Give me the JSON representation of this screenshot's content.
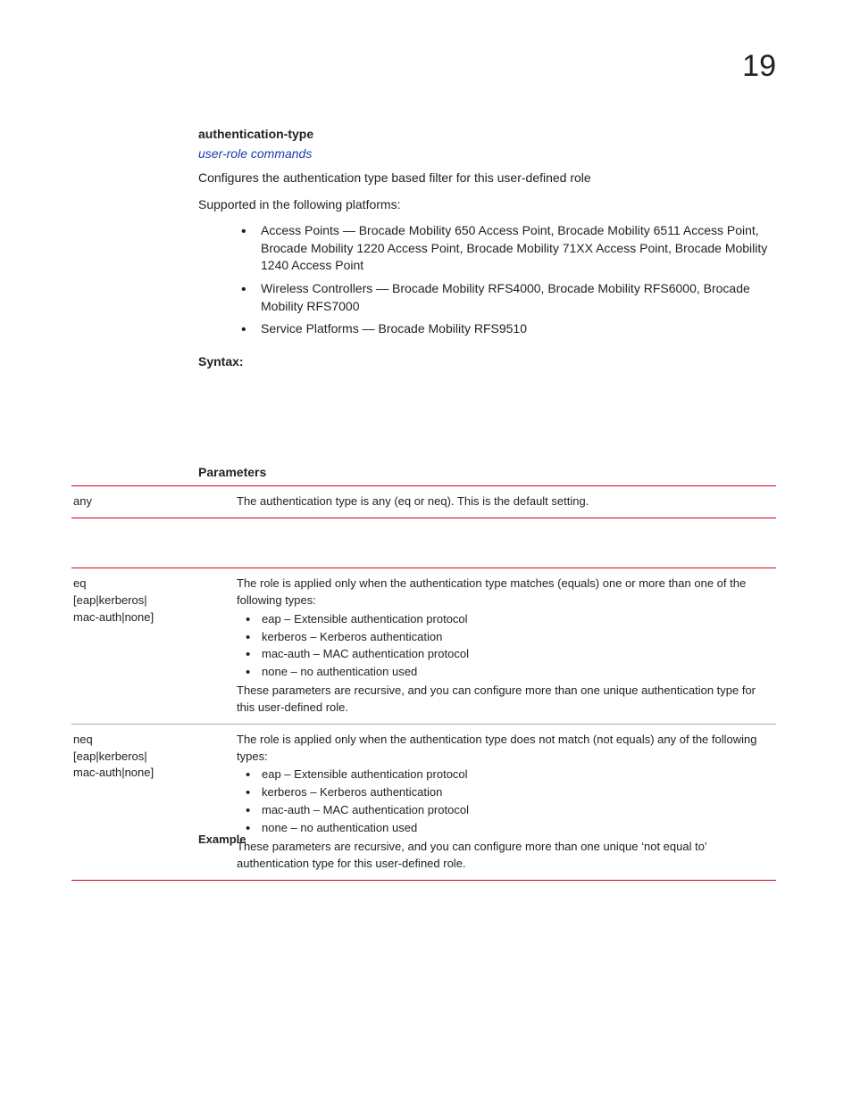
{
  "chapter_number": "19",
  "section": {
    "title": "authentication-type",
    "link": "user-role commands",
    "desc": "Configures the authentication type based filter for this user-defined role",
    "supported_intro": "Supported in the following platforms:",
    "platforms": [
      "Access Points — Brocade Mobility 650 Access Point, Brocade Mobility 6511 Access Point, Brocade Mobility 1220 Access Point, Brocade Mobility 71XX Access Point, Brocade Mobility 1240 Access Point",
      "Wireless Controllers — Brocade Mobility RFS4000, Brocade Mobility RFS6000, Brocade Mobility RFS7000",
      "Service Platforms — Brocade Mobility RFS9510"
    ],
    "syntax_label": "Syntax:",
    "parameters_label": "Parameters"
  },
  "table1": {
    "rows": [
      {
        "left": "any",
        "right_text": "The authentication type is any (eq or neq). This is the default setting."
      }
    ]
  },
  "table2": {
    "rows": [
      {
        "left_lines": [
          "eq",
          "[eap|kerberos|",
          "mac-auth|none]"
        ],
        "intro": "The role is applied only when the authentication type matches (equals) one or more than one of the following types:",
        "items": [
          "eap – Extensible authentication protocol",
          "kerberos – Kerberos authentication",
          "mac-auth – MAC authentication protocol",
          "none – no authentication used"
        ],
        "outro": "These parameters are recursive, and you can configure more than one unique authentication type for this user-defined role."
      },
      {
        "left_lines": [
          "neq",
          "[eap|kerberos|",
          "mac-auth|none]"
        ],
        "intro": "The role is applied only when the authentication type does not match (not equals) any of the following types:",
        "items": [
          "eap – Extensible authentication protocol",
          "kerberos – Kerberos authentication",
          "mac-auth – MAC authentication protocol",
          "none – no authentication used"
        ],
        "outro": "These parameters are recursive, and you can configure more than one unique ‘not equal to’ authentication type for this user-defined role."
      }
    ]
  },
  "example_label": "Example"
}
